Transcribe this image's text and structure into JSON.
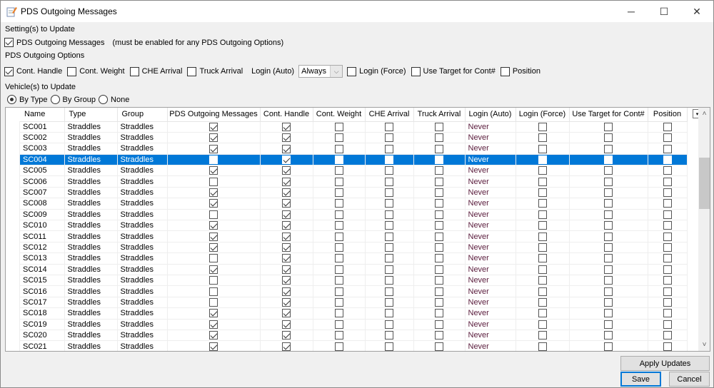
{
  "window": {
    "title": "PDS Outgoing Messages",
    "icon": "notepad-pencil-icon",
    "controls": {
      "minimize": "─",
      "maximize": "☐",
      "close": "✕"
    }
  },
  "settings": {
    "section_label": "Setting(s) to Update",
    "pds_outgoing": {
      "label": "PDS Outgoing Messages",
      "checked": true,
      "note": "(must be enabled for any PDS Outgoing Options)"
    }
  },
  "options": {
    "section_label": "PDS Outgoing Options",
    "items": [
      {
        "label": "Cont. Handle",
        "checked": true
      },
      {
        "label": "Cont. Weight",
        "checked": false
      },
      {
        "label": "CHE Arrival",
        "checked": false
      },
      {
        "label": "Truck Arrival",
        "checked": false
      }
    ],
    "login_auto": {
      "label": "Login (Auto)",
      "value": "Always",
      "arrow": "⌵"
    },
    "items2": [
      {
        "label": "Login (Force)",
        "checked": false
      },
      {
        "label": "Use Target for Cont#",
        "checked": false
      },
      {
        "label": "Position",
        "checked": false
      }
    ]
  },
  "vehicles": {
    "section_label": "Vehicle(s) to Update",
    "radios": [
      {
        "label": "By Type",
        "checked": true
      },
      {
        "label": "By Group",
        "checked": false
      },
      {
        "label": "None",
        "checked": false
      }
    ]
  },
  "grid": {
    "columns": [
      "Name",
      "Type",
      "Group",
      "PDS Outgoing Messages",
      "Cont. Handle",
      "Cont. Weight",
      "CHE Arrival",
      "Truck Arrival",
      "Login (Auto)",
      "Login (Force)",
      "Use Target for Cont#",
      "Position"
    ],
    "selected_row": 3,
    "rows": [
      {
        "name": "SC001",
        "type": "Straddles",
        "group": "Straddles",
        "pds": true,
        "handle": true,
        "weight": false,
        "che": false,
        "truck": false,
        "login_auto": "Never",
        "login_force": false,
        "target": false,
        "position": false
      },
      {
        "name": "SC002",
        "type": "Straddles",
        "group": "Straddles",
        "pds": true,
        "handle": true,
        "weight": false,
        "che": false,
        "truck": false,
        "login_auto": "Never",
        "login_force": false,
        "target": false,
        "position": false
      },
      {
        "name": "SC003",
        "type": "Straddles",
        "group": "Straddles",
        "pds": true,
        "handle": true,
        "weight": false,
        "che": false,
        "truck": false,
        "login_auto": "Never",
        "login_force": false,
        "target": false,
        "position": false
      },
      {
        "name": "SC004",
        "type": "Straddles",
        "group": "Straddles",
        "pds": false,
        "handle": true,
        "weight": false,
        "che": false,
        "truck": false,
        "login_auto": "Never",
        "login_force": false,
        "target": false,
        "position": false
      },
      {
        "name": "SC005",
        "type": "Straddles",
        "group": "Straddles",
        "pds": true,
        "handle": true,
        "weight": false,
        "che": false,
        "truck": false,
        "login_auto": "Never",
        "login_force": false,
        "target": false,
        "position": false
      },
      {
        "name": "SC006",
        "type": "Straddles",
        "group": "Straddles",
        "pds": false,
        "handle": true,
        "weight": false,
        "che": false,
        "truck": false,
        "login_auto": "Never",
        "login_force": false,
        "target": false,
        "position": false
      },
      {
        "name": "SC007",
        "type": "Straddles",
        "group": "Straddles",
        "pds": true,
        "handle": true,
        "weight": false,
        "che": false,
        "truck": false,
        "login_auto": "Never",
        "login_force": false,
        "target": false,
        "position": false
      },
      {
        "name": "SC008",
        "type": "Straddles",
        "group": "Straddles",
        "pds": true,
        "handle": true,
        "weight": false,
        "che": false,
        "truck": false,
        "login_auto": "Never",
        "login_force": false,
        "target": false,
        "position": false
      },
      {
        "name": "SC009",
        "type": "Straddles",
        "group": "Straddles",
        "pds": false,
        "handle": true,
        "weight": false,
        "che": false,
        "truck": false,
        "login_auto": "Never",
        "login_force": false,
        "target": false,
        "position": false
      },
      {
        "name": "SC010",
        "type": "Straddles",
        "group": "Straddles",
        "pds": true,
        "handle": true,
        "weight": false,
        "che": false,
        "truck": false,
        "login_auto": "Never",
        "login_force": false,
        "target": false,
        "position": false
      },
      {
        "name": "SC011",
        "type": "Straddles",
        "group": "Straddles",
        "pds": true,
        "handle": true,
        "weight": false,
        "che": false,
        "truck": false,
        "login_auto": "Never",
        "login_force": false,
        "target": false,
        "position": false
      },
      {
        "name": "SC012",
        "type": "Straddles",
        "group": "Straddles",
        "pds": true,
        "handle": true,
        "weight": false,
        "che": false,
        "truck": false,
        "login_auto": "Never",
        "login_force": false,
        "target": false,
        "position": false
      },
      {
        "name": "SC013",
        "type": "Straddles",
        "group": "Straddles",
        "pds": false,
        "handle": true,
        "weight": false,
        "che": false,
        "truck": false,
        "login_auto": "Never",
        "login_force": false,
        "target": false,
        "position": false
      },
      {
        "name": "SC014",
        "type": "Straddles",
        "group": "Straddles",
        "pds": true,
        "handle": true,
        "weight": false,
        "che": false,
        "truck": false,
        "login_auto": "Never",
        "login_force": false,
        "target": false,
        "position": false
      },
      {
        "name": "SC015",
        "type": "Straddles",
        "group": "Straddles",
        "pds": false,
        "handle": true,
        "weight": false,
        "che": false,
        "truck": false,
        "login_auto": "Never",
        "login_force": false,
        "target": false,
        "position": false
      },
      {
        "name": "SC016",
        "type": "Straddles",
        "group": "Straddles",
        "pds": false,
        "handle": true,
        "weight": false,
        "che": false,
        "truck": false,
        "login_auto": "Never",
        "login_force": false,
        "target": false,
        "position": false
      },
      {
        "name": "SC017",
        "type": "Straddles",
        "group": "Straddles",
        "pds": false,
        "handle": true,
        "weight": false,
        "che": false,
        "truck": false,
        "login_auto": "Never",
        "login_force": false,
        "target": false,
        "position": false
      },
      {
        "name": "SC018",
        "type": "Straddles",
        "group": "Straddles",
        "pds": true,
        "handle": true,
        "weight": false,
        "che": false,
        "truck": false,
        "login_auto": "Never",
        "login_force": false,
        "target": false,
        "position": false
      },
      {
        "name": "SC019",
        "type": "Straddles",
        "group": "Straddles",
        "pds": true,
        "handle": true,
        "weight": false,
        "che": false,
        "truck": false,
        "login_auto": "Never",
        "login_force": false,
        "target": false,
        "position": false
      },
      {
        "name": "SC020",
        "type": "Straddles",
        "group": "Straddles",
        "pds": true,
        "handle": true,
        "weight": false,
        "che": false,
        "truck": false,
        "login_auto": "Never",
        "login_force": false,
        "target": false,
        "position": false
      },
      {
        "name": "SC021",
        "type": "Straddles",
        "group": "Straddles",
        "pds": true,
        "handle": true,
        "weight": false,
        "che": false,
        "truck": false,
        "login_auto": "Never",
        "login_force": false,
        "target": false,
        "position": false
      }
    ],
    "column_chooser": "▾",
    "scroll_up": "˄",
    "scroll_down": "˅"
  },
  "buttons": {
    "apply": "Apply Updates",
    "save": "Save",
    "cancel": "Cancel"
  },
  "colors": {
    "selection": "#0078d7",
    "default_button_border": "#0078d7"
  }
}
